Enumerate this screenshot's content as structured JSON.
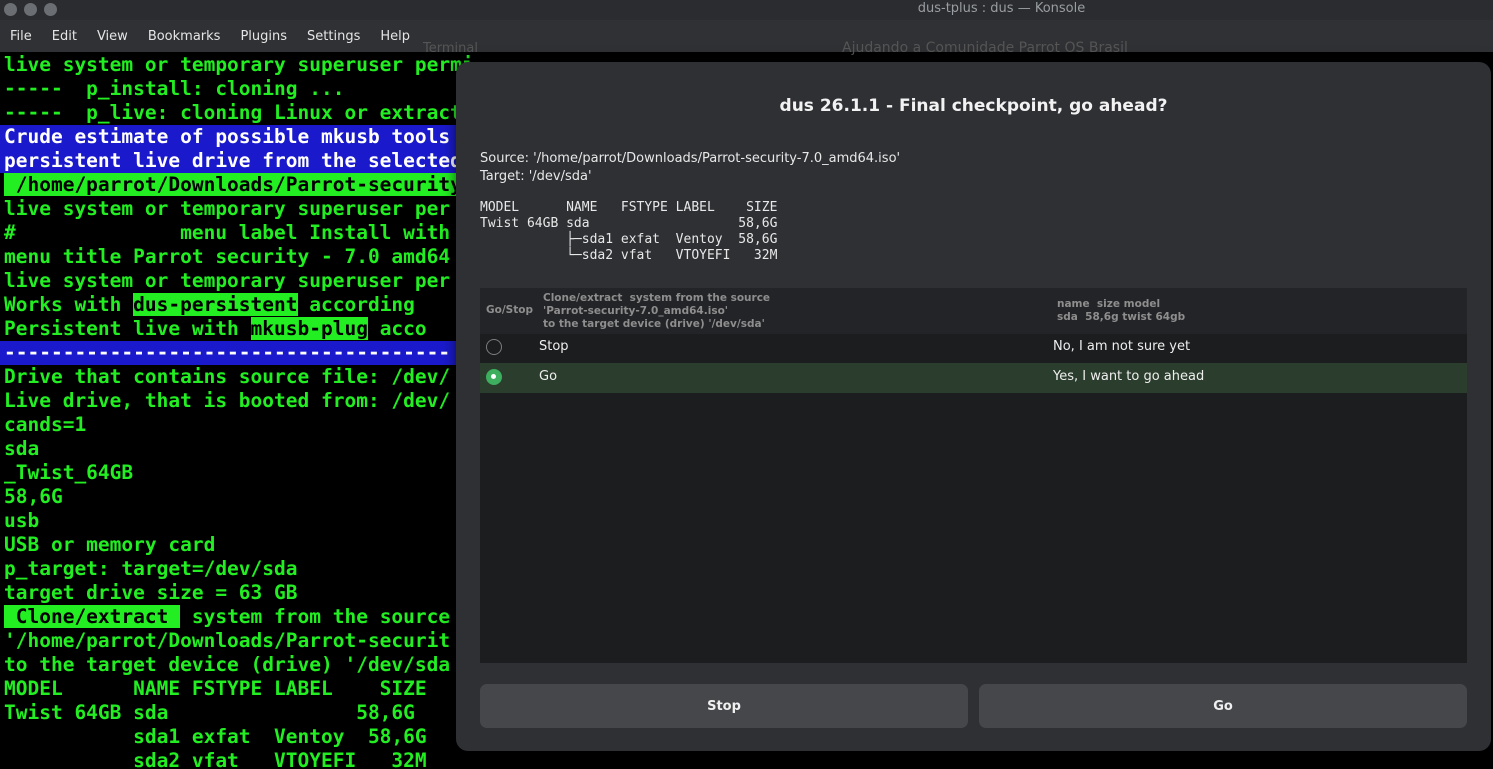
{
  "window": {
    "title": "dus-tplus : dus — Konsole"
  },
  "menu": {
    "items": [
      "File",
      "Edit",
      "View",
      "Bookmarks",
      "Plugins",
      "Settings",
      "Help"
    ],
    "bg_text_left": "Terminal",
    "bg_text_right": "Ajudando a Comunidade Parrot OS Brasil"
  },
  "terminal": {
    "lines": [
      "live system or temporary superuser permissions",
      "-----  p_install: cloning ...",
      "-----  p_live: cloning Linux or extracting",
      "Crude estimate of possible mkusb tools",
      "persistent live drive from the selected",
      " /home/parrot/Downloads/Parrot-security",
      "live system or temporary superuser per",
      "#              menu label Install with",
      "menu title Parrot security - 7.0 amd64",
      "live system or temporary superuser per",
      "Works with ",
      "dus-persistent",
      " according",
      "Persistent live with ",
      "mkusb-plug",
      " acco",
      "--------------------------------------",
      "Drive that contains source file: /dev/",
      "Live drive, that is booted from: /dev/",
      "cands=1",
      "sda",
      "_Twist_64GB",
      "58,6G",
      "usb",
      "USB or memory card",
      "p_target: target=/dev/sda",
      "target drive size = 63 GB",
      " Clone/extract ",
      " system from the source",
      "'/home/parrot/Downloads/Parrot-securit",
      "to the target device (drive) '/dev/sda",
      "MODEL      NAME FSTYPE LABEL    SIZE",
      "Twist 64GB sda                58,6G",
      "           sda1 exfat  Ventoy  58,6G",
      "           sda2 vfat   VTOYEFI   32M"
    ]
  },
  "dialog": {
    "title": "dus 26.1.1 - Final checkpoint, go ahead?",
    "source": "Source: '/home/parrot/Downloads/Parrot-security-7.0_amd64.iso'",
    "target": "Target: '/dev/sda'",
    "device_table": "MODEL      NAME   FSTYPE LABEL    SIZE\nTwist 64GB sda                   58,6G\n           ├─sda1 exfat  Ventoy  58,6G\n           └─sda2 vfat   VTOYEFI   32M",
    "list": {
      "col1": "Go/Stop",
      "col2": "Clone/extract  system from the source\n'Parrot-security-7.0_amd64.iso'\nto the target device (drive) '/dev/sda'",
      "col3": "name  size model\nsda  58,6g twist 64gb",
      "rows": [
        {
          "label": "Stop",
          "desc": "No, I am not sure yet",
          "selected": false
        },
        {
          "label": "Go",
          "desc": "Yes, I want to go ahead",
          "selected": true
        }
      ]
    },
    "buttons": {
      "stop": "Stop",
      "go": "Go"
    }
  },
  "colors": {
    "terminal_green": "#22ee22",
    "terminal_blue": "#1a1acc",
    "radio_selected": "#3daf5e"
  }
}
